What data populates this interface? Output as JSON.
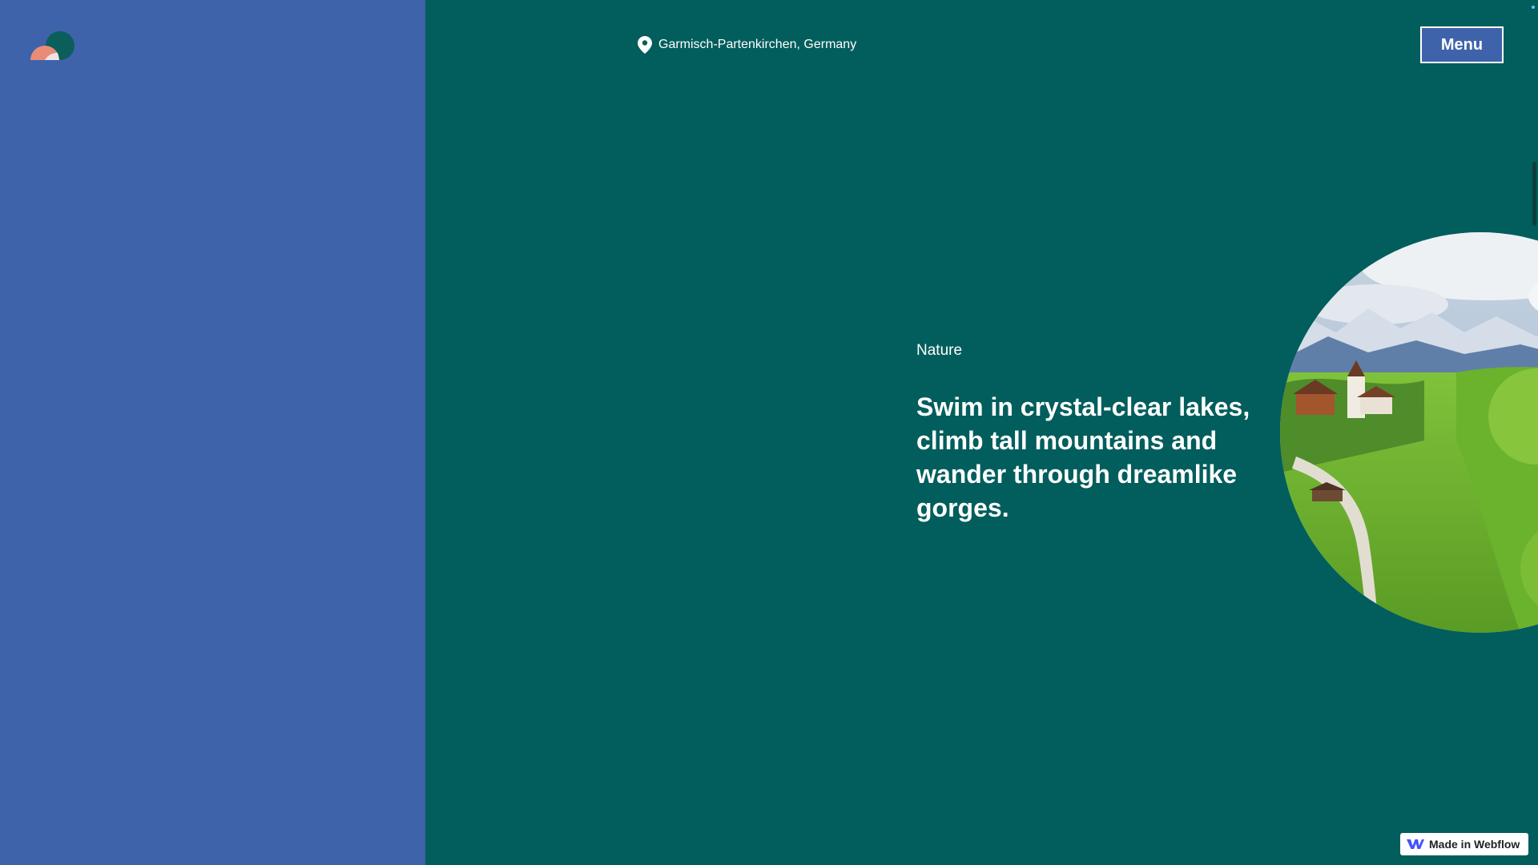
{
  "header": {
    "location": "Garmisch-Partenkirchen, Germany",
    "location_icon": "map-pin-icon",
    "menu_label": "Menu"
  },
  "logo_icon": "half-circles-logo-icon",
  "main": {
    "category": "Nature",
    "headline": "Swim in crystal-clear lakes, climb tall mountains and wander through dreamlike gorges.",
    "image_icon": "alpine-village-photo"
  },
  "badge": {
    "label": "Made in Webflow",
    "icon": "webflow-logo-icon"
  },
  "colors": {
    "left_panel": "#3e63aa",
    "right_panel": "#015e5c",
    "menu_button_bg": "#3e63aa",
    "text": "#ffffff"
  }
}
